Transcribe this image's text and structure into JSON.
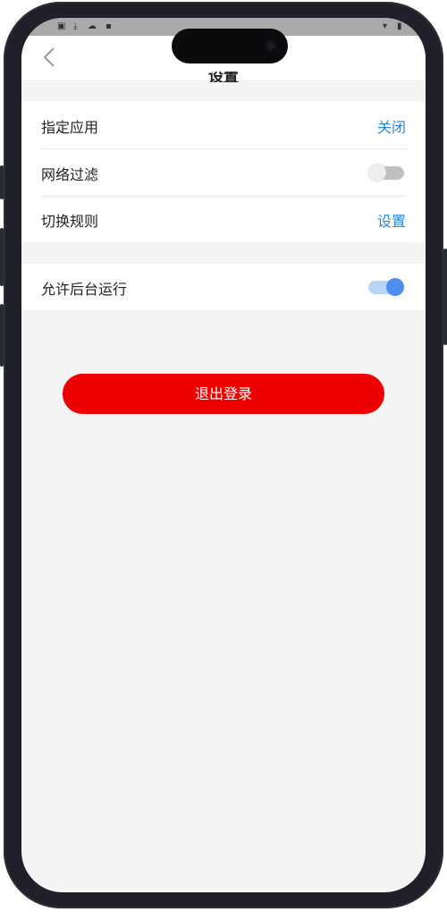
{
  "navbar": {
    "title": "设置",
    "back_icon": "chevron-left-icon"
  },
  "group1": {
    "rows": [
      {
        "label": "指定应用",
        "value": "关闭"
      },
      {
        "label": "网络过滤",
        "toggle": false
      },
      {
        "label": "切换规则",
        "value": "设置"
      }
    ]
  },
  "group2": {
    "rows": [
      {
        "label": "允许后台运行",
        "toggle": true
      }
    ]
  },
  "logout": {
    "label": "退出登录"
  },
  "colors": {
    "accent_link": "#2a86e0",
    "logout_bg": "#ee0000",
    "toggle_on": "#4f8ef0",
    "toggle_off": "#d0d0d0"
  }
}
